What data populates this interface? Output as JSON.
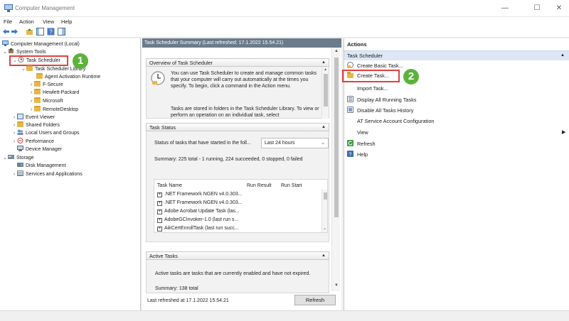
{
  "window": {
    "title": "Computer Management",
    "minimize": "—",
    "maximize": "☐",
    "close": "✕"
  },
  "menu": {
    "file": "File",
    "action": "Action",
    "view": "View",
    "help": "Help"
  },
  "tree": {
    "root": "Computer Management (Local)",
    "system_tools": "System Tools",
    "task_scheduler": "Task Scheduler",
    "task_scheduler_library": "Task Scheduler Library",
    "agent_activation_runtime": "Agent Activation Runtime",
    "f_secure": "F-Secure",
    "hewlett_packard": "Hewlett-Packard",
    "microsoft": "Microsoft",
    "remote_desktop": "RemoteDesktop",
    "event_viewer": "Event Viewer",
    "shared_folders": "Shared Folders",
    "local_users_groups": "Local Users and Groups",
    "performance": "Performance",
    "device_manager": "Device Manager",
    "storage": "Storage",
    "disk_management": "Disk Management",
    "services_apps": "Services and Applications"
  },
  "summary": {
    "header": "Task Scheduler Summary (Last refreshed: 17.1.2022 15.54.21)",
    "overview_title": "Overview of Task Scheduler",
    "overview_p1": "You can use Task Scheduler to create and manage common tasks that your computer will carry out automatically at the times you specify. To begin, click a command in the Action menu.",
    "overview_p2": "Tasks are stored in folders in the Task Scheduler Library. To view or perform an operation on an individual task, select",
    "status_title": "Task Status",
    "status_label": "Status of tasks that have started in the foll...",
    "status_select": "Last 24 hours",
    "status_summary": "Summary: 225 total - 1 running, 224 succeeded, 0 stopped, 0 failed",
    "columns": [
      "Task Name",
      "Run Result",
      "Run Start"
    ],
    "tasks": [
      ".NET Framework NGEN v4.0.303...",
      ".NET Framework NGEN v4.0.303...",
      "Adobe Acrobat Update Task (las...",
      "AdobeGCInvoker-1.0 (last run s...",
      "AikCertEnrollTask (last run succ..."
    ],
    "active_title": "Active Tasks",
    "active_desc": "Active tasks are tasks that are currently enabled and have not expired.",
    "active_summary": "Summary: 138 total",
    "last_refreshed": "Last refreshed at 17.1.2022 15.54.21",
    "refresh_button": "Refresh"
  },
  "actions": {
    "header": "Actions",
    "section": "Task Scheduler",
    "items": [
      "Create Basic Task...",
      "Create Task...",
      "Import Task...",
      "Display All Running Tasks",
      "Disable All Tasks History",
      "AT Service Account Configuration",
      "View",
      "Refresh",
      "Help"
    ]
  },
  "annotations": {
    "badge1": "1",
    "badge2": "2"
  },
  "colors": {
    "highlight": "#e04040",
    "badge": "#5bb33a",
    "section_bg": "#dce6f4"
  }
}
